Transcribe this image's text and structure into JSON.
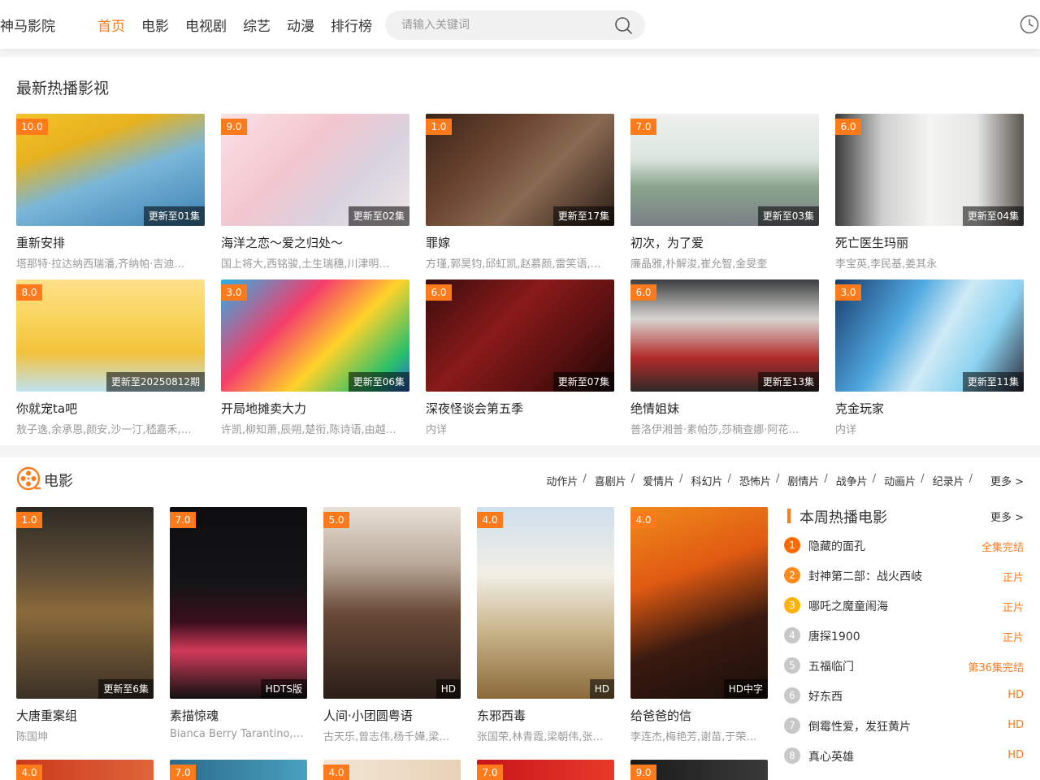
{
  "header": {
    "logo": "神马影院",
    "nav": [
      "首页",
      "电影",
      "电视剧",
      "综艺",
      "动漫",
      "排行榜"
    ],
    "search_placeholder": "请输入关键词"
  },
  "colors": {
    "accent": "#ff7a1a",
    "badge_rank_top": [
      "#ff6a00",
      "#ff8c1a",
      "#ffb300"
    ],
    "badge_rank_other": "#c8c8c8"
  },
  "section_hot": {
    "title": "最新热播影视",
    "items": [
      {
        "score": "10.0",
        "status": "更新至01集",
        "title": "重新安排",
        "cast": "塔那特·拉达纳西瑞潘,齐纳帕·吉迪…"
      },
      {
        "score": "9.0",
        "status": "更新至02集",
        "title": "海洋之恋～爱之归处～",
        "cast": "国上将大,西铭骏,土生瑞穗,川津明…"
      },
      {
        "score": "1.0",
        "status": "更新至17集",
        "title": "罪嫁",
        "cast": "方瑾,郭昊钧,邱虹凯,赵慕颜,雷笑语,…"
      },
      {
        "score": "7.0",
        "status": "更新至03集",
        "title": "初次，为了爱",
        "cast": "廉晶雅,朴解浚,崔允智,金旻奎"
      },
      {
        "score": "6.0",
        "status": "更新至04集",
        "title": "死亡医生玛丽",
        "cast": "李宝英,李民基,姜其永"
      },
      {
        "score": "8.0",
        "status": "更新至20250812期",
        "title": "你就宠ta吧",
        "cast": "敖子逸,余承恩,颜安,沙一汀,嵇嘉禾,…"
      },
      {
        "score": "3.0",
        "status": "更新至06集",
        "title": "开局地摊卖大力",
        "cast": "许凯,柳知萧,辰朔,楚衔,陈诗语,由越…"
      },
      {
        "score": "6.0",
        "status": "更新至07集",
        "title": "深夜怪谈会第五季",
        "cast": "内详"
      },
      {
        "score": "6.0",
        "status": "更新至13集",
        "title": "绝情姐妹",
        "cast": "普洛伊湘普·素帕莎,莎楠查娜·阿花…"
      },
      {
        "score": "3.0",
        "status": "更新至11集",
        "title": "克金玩家",
        "cast": "内详"
      }
    ]
  },
  "section_movie": {
    "title": "电影",
    "genres": [
      "动作片",
      "喜剧片",
      "爱情片",
      "科幻片",
      "恐怖片",
      "剧情片",
      "战争片",
      "动画片",
      "纪录片"
    ],
    "more": "更多 >",
    "items": [
      {
        "score": "1.0",
        "status": "更新至6集",
        "title": "大唐重案组",
        "cast": "陈国坤"
      },
      {
        "score": "7.0",
        "status": "HDTS版",
        "title": "素描惊魂",
        "cast": "Bianca Berry Tarantino,A…"
      },
      {
        "score": "5.0",
        "status": "HD",
        "title": "人间·小团圆粤语",
        "cast": "古天乐,曾志伟,杨千嬅,梁…"
      },
      {
        "score": "4.0",
        "status": "HD",
        "title": "东邪西毒",
        "cast": "张国荣,林青霞,梁朝伟,张…"
      },
      {
        "score": "4.0",
        "status": "HD中字",
        "title": "给爸爸的信",
        "cast": "李连杰,梅艳芳,谢苗,于荣…"
      }
    ],
    "row2_scores": [
      "4.0",
      "7.0",
      "4.0",
      "7.0",
      "9.0"
    ]
  },
  "weekly_rank": {
    "title": "本周热播电影",
    "more": "更多 >",
    "items": [
      {
        "num": "1",
        "name": "隐藏的面孔",
        "tag": "全集完结"
      },
      {
        "num": "2",
        "name": "封神第二部：战火西岐",
        "tag": "正片"
      },
      {
        "num": "3",
        "name": "哪吒之魔童闹海",
        "tag": "正片"
      },
      {
        "num": "4",
        "name": "唐探1900",
        "tag": "正片"
      },
      {
        "num": "5",
        "name": "五福临门",
        "tag": "第36集完结"
      },
      {
        "num": "6",
        "name": "好东西",
        "tag": "HD"
      },
      {
        "num": "7",
        "name": "倒霉性爱，发狂黄片",
        "tag": "HD"
      },
      {
        "num": "8",
        "name": "真心英雄",
        "tag": "HD"
      }
    ]
  }
}
